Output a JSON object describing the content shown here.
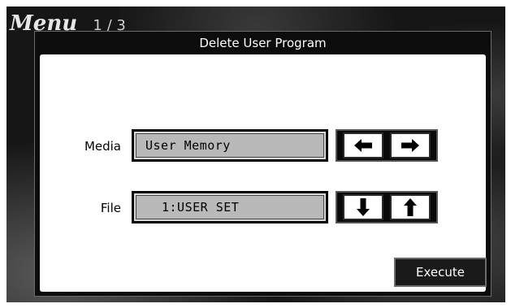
{
  "background": {
    "menu_title": "Menu",
    "menu_page": "1 / 3"
  },
  "dialog": {
    "title": "Delete User Program",
    "media": {
      "label": "Media",
      "value": "User Memory",
      "left_icon": "left-arrow-icon",
      "right_icon": "right-arrow-icon"
    },
    "file": {
      "label": "File",
      "value": "1:USER SET",
      "down_icon": "down-arrow-icon",
      "up_icon": "up-arrow-icon"
    },
    "execute_label": "Execute"
  },
  "colors": {
    "dialog_frame": "#0c0c0c",
    "field_fill": "#b9b9b9",
    "dialog_body": "#ffffff"
  }
}
